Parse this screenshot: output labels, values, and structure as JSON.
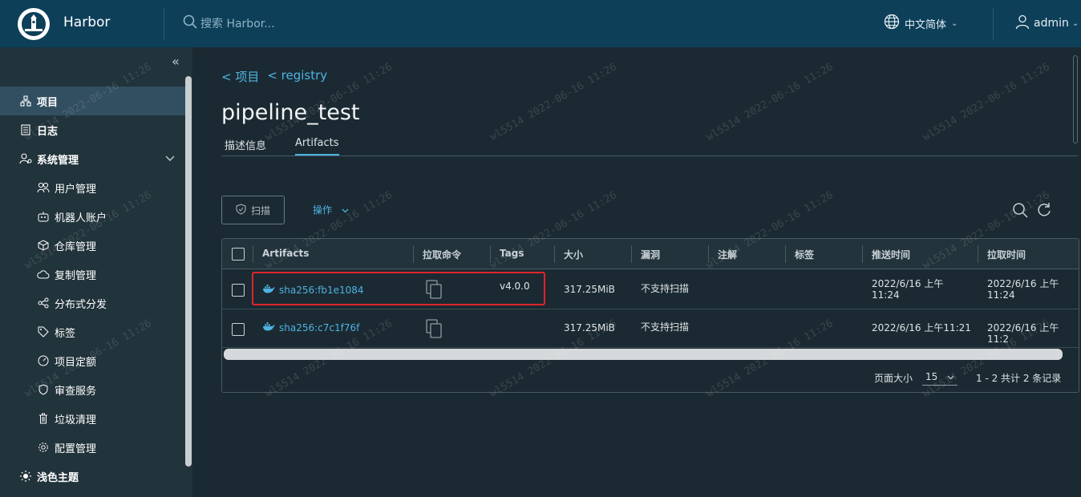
{
  "header": {
    "brand": "Harbor",
    "search_placeholder": "搜索 Harbor...",
    "language": "中文简体",
    "user": "admin"
  },
  "sidebar": {
    "items": [
      {
        "label": "项目",
        "icon": "project-icon"
      },
      {
        "label": "日志",
        "icon": "log-icon"
      },
      {
        "label": "系统管理",
        "icon": "admin-icon"
      },
      {
        "label": "用户管理",
        "icon": "users-icon"
      },
      {
        "label": "机器人账户",
        "icon": "robot-icon"
      },
      {
        "label": "仓库管理",
        "icon": "cube-icon"
      },
      {
        "label": "复制管理",
        "icon": "cloud-icon"
      },
      {
        "label": "分布式分发",
        "icon": "share-icon"
      },
      {
        "label": "标签",
        "icon": "tag-icon"
      },
      {
        "label": "项目定额",
        "icon": "dashboard-icon"
      },
      {
        "label": "审查服务",
        "icon": "shield-icon"
      },
      {
        "label": "垃圾清理",
        "icon": "trash-icon"
      },
      {
        "label": "配置管理",
        "icon": "gear-icon"
      },
      {
        "label": "浅色主题",
        "icon": "sun-icon"
      }
    ]
  },
  "breadcrumb": {
    "project": "< 项目",
    "repo": "< registry"
  },
  "page_title": "pipeline_test",
  "tabs": {
    "info": "描述信息",
    "artifacts": "Artifacts"
  },
  "toolbar": {
    "scan": "扫描",
    "actions": "操作"
  },
  "table": {
    "columns": [
      "Artifacts",
      "拉取命令",
      "Tags",
      "大小",
      "漏洞",
      "注解",
      "标签",
      "推送时间",
      "拉取时间"
    ],
    "rows": [
      {
        "digest": "sha256:fb1e1084",
        "tags": "v4.0.0",
        "size": "317.25MiB",
        "vuln": "不支持扫描",
        "push_time_1": "2022/6/16 上午",
        "push_time_2": "11:24",
        "pull_time_1": "2022/6/16 上午",
        "pull_time_2": "11:24"
      },
      {
        "digest": "sha256:c7c1f76f",
        "tags": "",
        "size": "317.25MiB",
        "vuln": "不支持扫描",
        "push_time_1": "2022/6/16 上午11:21",
        "pull_time_1": "2022/6/16 上午11:2"
      }
    ]
  },
  "pagination": {
    "page_size_label": "页面大小",
    "page_size": "15",
    "summary": "1 - 2 共计 2 条记录"
  },
  "watermark": "wl5514 2022-06-16 11:26",
  "colors": {
    "header": "#0d3f59",
    "sidebar": "#21333b",
    "background": "#1b2a32",
    "accent": "#4fb2e3",
    "highlight": "#e0242a"
  }
}
